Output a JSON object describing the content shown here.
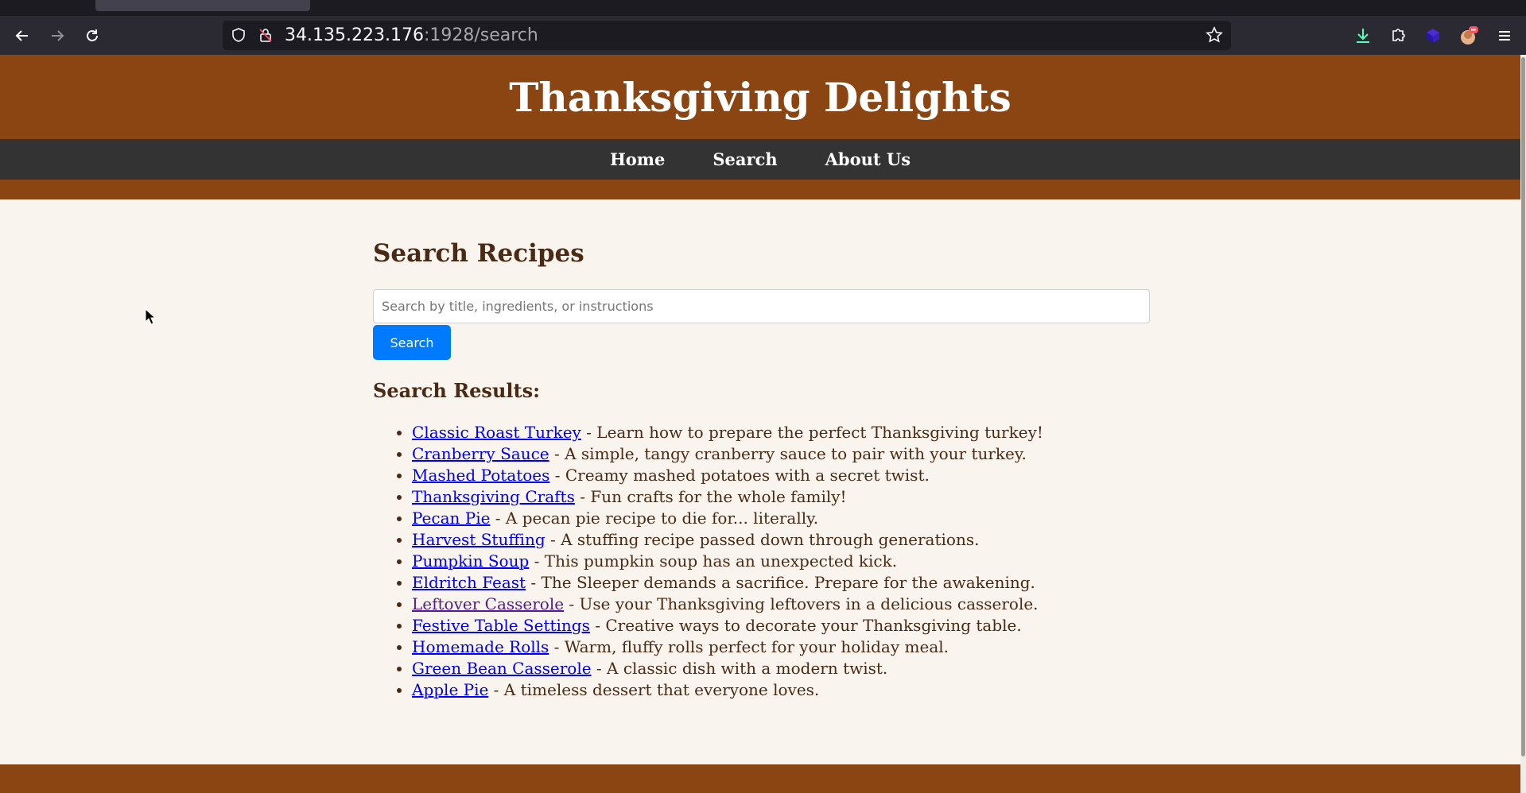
{
  "browser": {
    "url_host": "34.135.223.176",
    "url_rest": ":1928/search"
  },
  "site": {
    "title": "Thanksgiving Delights",
    "nav": [
      "Home",
      "Search",
      "About Us"
    ]
  },
  "search": {
    "heading": "Search Recipes",
    "placeholder": "Search by title, ingredients, or instructions",
    "value": "",
    "button_label": "Search",
    "results_heading": "Search Results:"
  },
  "results": [
    {
      "title": "Classic Roast Turkey",
      "desc": " - Learn how to prepare the perfect Thanksgiving turkey!",
      "visited": false
    },
    {
      "title": "Cranberry Sauce",
      "desc": " - A simple, tangy cranberry sauce to pair with your turkey.",
      "visited": false
    },
    {
      "title": "Mashed Potatoes",
      "desc": " - Creamy mashed potatoes with a secret twist.",
      "visited": false
    },
    {
      "title": "Thanksgiving Crafts",
      "desc": " - Fun crafts for the whole family!",
      "visited": false
    },
    {
      "title": "Pecan Pie",
      "desc": " - A pecan pie recipe to die for... literally.",
      "visited": false
    },
    {
      "title": "Harvest Stuffing",
      "desc": " - A stuffing recipe passed down through generations.",
      "visited": false
    },
    {
      "title": "Pumpkin Soup",
      "desc": " - This pumpkin soup has an unexpected kick.",
      "visited": false
    },
    {
      "title": "Eldritch Feast",
      "desc": " - The Sleeper demands a sacrifice. Prepare for the awakening.",
      "visited": false
    },
    {
      "title": "Leftover Casserole",
      "desc": " - Use your Thanksgiving leftovers in a delicious casserole.",
      "visited": true
    },
    {
      "title": "Festive Table Settings",
      "desc": " - Creative ways to decorate your Thanksgiving table.",
      "visited": false
    },
    {
      "title": "Homemade Rolls",
      "desc": " - Warm, fluffy rolls perfect for your holiday meal.",
      "visited": false
    },
    {
      "title": "Green Bean Casserole",
      "desc": " - A classic dish with a modern twist.",
      "visited": false
    },
    {
      "title": "Apple Pie",
      "desc": " - A timeless dessert that everyone loves.",
      "visited": false
    }
  ],
  "colors": {
    "brand_brown": "#8b4513",
    "nav_dark": "#333333",
    "button_blue": "#007bff",
    "page_bg": "#f9f5ee",
    "link": "#0000ee",
    "link_visited": "#551a8b"
  },
  "icons": {
    "back": "back-arrow-icon",
    "forward": "forward-arrow-icon",
    "reload": "reload-icon",
    "shield": "shield-icon",
    "lock": "insecure-lock-icon",
    "bookmark": "star-icon",
    "downloads": "download-icon",
    "extensions": "puzzle-icon",
    "menu": "hamburger-menu-icon"
  }
}
